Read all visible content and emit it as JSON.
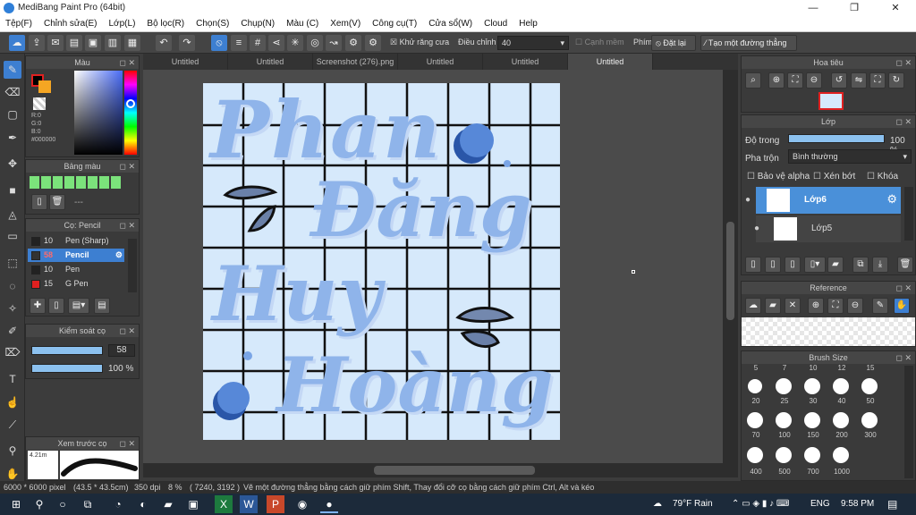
{
  "window": {
    "title": "MediBang Paint Pro (64bit)",
    "min": "—",
    "max": "❐",
    "close": "✕"
  },
  "menu": [
    "Tệp(F)",
    "Chỉnh sửa(E)",
    "Lớp(L)",
    "Bộ lọc(R)",
    "Chọn(S)",
    "Chụp(N)",
    "Màu (C)",
    "Xem(V)",
    "Công cụ(T)",
    "Cửa sổ(W)",
    "Cloud",
    "Help"
  ],
  "toolbar": {
    "antialias_label": "Khử răng cưa",
    "correction_label": "Điều chỉnh",
    "correction_value": "40",
    "soft_edge_label": "Cạnh mềm",
    "key_label": "Phím",
    "reset_label": "Đặt lại",
    "straight_line_label": "Tạo một đường thẳng"
  },
  "tabs": [
    "Untitled",
    "Untitled",
    "Screenshot (276).png",
    "Untitled",
    "Untitled",
    "Untitled"
  ],
  "color_panel": {
    "title": "Màu",
    "r": "R:0",
    "g": "G:0",
    "b": "B:0",
    "hex": "#000000"
  },
  "palette_panel": {
    "title": "Bảng màu",
    "dash": "---"
  },
  "brush_panel": {
    "title": "Cọ: Pencil",
    "brushes": [
      {
        "size": "10",
        "name": "Pen (Sharp)",
        "color": "#222222"
      },
      {
        "size": "58",
        "name": "Pencil",
        "color": "#333333"
      },
      {
        "size": "10",
        "name": "Pen",
        "color": "#222222"
      },
      {
        "size": "15",
        "name": "G Pen",
        "color": "#e02020"
      }
    ]
  },
  "brush_control": {
    "title": "Kiểm soát cọ",
    "size": "58",
    "opacity": "100 %",
    "size_fill": 1.0,
    "opacity_fill": 1.0
  },
  "preview_panel": {
    "title": "Xem trước cọ",
    "size_label": "4.21m"
  },
  "navigator": {
    "title": "Hoa tiêu"
  },
  "layer_panel": {
    "title": "Lớp",
    "opacity_label": "Độ trong",
    "opacity_value": "100 %",
    "blend_label": "Pha trộn",
    "blend_value": "Bình thường",
    "protect_alpha": "Bảo vệ alpha",
    "clipping": "Xén bớt",
    "lock": "Khóa",
    "layers": [
      "Lớp6",
      "Lớp5"
    ]
  },
  "reference": {
    "title": "Reference"
  },
  "brush_size": {
    "title": "Brush Size",
    "top_row": [
      "5",
      "7",
      "10",
      "12",
      "15"
    ],
    "rows": [
      [
        "20",
        "25",
        "30",
        "40",
        "50"
      ],
      [
        "70",
        "100",
        "150",
        "200",
        "300"
      ],
      [
        "400",
        "500",
        "700",
        "1000"
      ]
    ]
  },
  "artwork": {
    "text_lines": [
      "Phan",
      "Đăng",
      "Huy",
      "Hoàng"
    ],
    "bg": "#d6e9fb",
    "grid_color": "#111111",
    "ink_color": "#8fb4ea"
  },
  "status": {
    "dims": "6000 * 6000 pixel",
    "cm": "(43.5 * 43.5cm)",
    "dpi": "350 dpi",
    "zoom": "8 %",
    "coords": "( 7240, 3192 )",
    "hint": "Vẽ một đường thẳng bằng cách giữ phím Shift, Thay đổi cỡ cọ bằng cách giữ phím Ctrl, Alt và kéo"
  },
  "taskbar": {
    "weather": "79°F Rain",
    "lang": "ENG",
    "time": "9:58 PM"
  }
}
